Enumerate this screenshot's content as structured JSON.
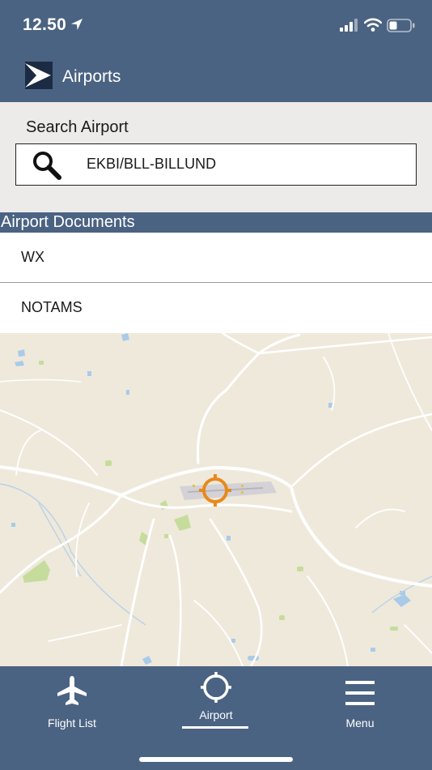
{
  "status_bar": {
    "time": "12.50"
  },
  "nav": {
    "title": "Airports"
  },
  "search": {
    "label": "Search Airport",
    "value": "EKBI/BLL-BILLUND"
  },
  "section_header": "Airport Documents",
  "documents": [
    {
      "label": "WX"
    },
    {
      "label": "NOTAMS"
    }
  ],
  "map": {
    "marker": "target-crosshair-icon",
    "marker_color": "#e8891b"
  },
  "tabs": [
    {
      "label": "Flight List",
      "icon": "airplane-icon"
    },
    {
      "label": "Airport",
      "icon": "crosshair-icon",
      "selected": true
    },
    {
      "label": "Menu",
      "icon": "hamburger-menu-icon"
    }
  ],
  "colors": {
    "bar": "#4b6382",
    "search_bg": "#ecebe9",
    "map_bg": "#efe9dc"
  }
}
